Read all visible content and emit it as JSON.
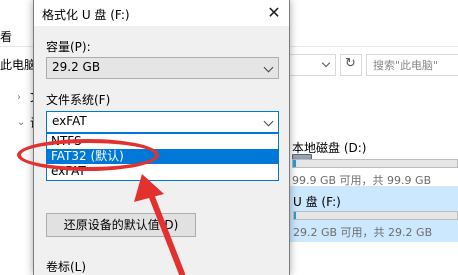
{
  "explorer": {
    "left_tab_label": "看",
    "breadcrumb_label": "此电脑",
    "search_placeholder": "搜索\"此电脑\"",
    "tree_label_1": "文",
    "tree_label_2": "设",
    "drives": [
      {
        "name": "本地磁盘 (D:)",
        "free_text": "99.9 GB 可用，共 99.9 GB",
        "used_fraction": 0.02
      },
      {
        "name": "U 盘 (F:)",
        "free_text": "29.2 GB 可用，共 29.2 GB",
        "used_fraction": 0.01
      }
    ]
  },
  "dialog": {
    "title": "格式化 U 盘 (F:)",
    "close_glyph": "✕",
    "capacity_label": "容量(P):",
    "capacity_value": "29.2 GB",
    "filesystem_label": "文件系统(F)",
    "filesystem_value": "exFAT",
    "filesystem_options": [
      "NTFS",
      "FAT32 (默认)",
      "exFAT"
    ],
    "selected_option_index": 1,
    "restore_defaults_button": "还原设备的默认值(D)",
    "volume_label": "卷标(L)"
  },
  "annotation": {
    "color": "#e3312f"
  }
}
